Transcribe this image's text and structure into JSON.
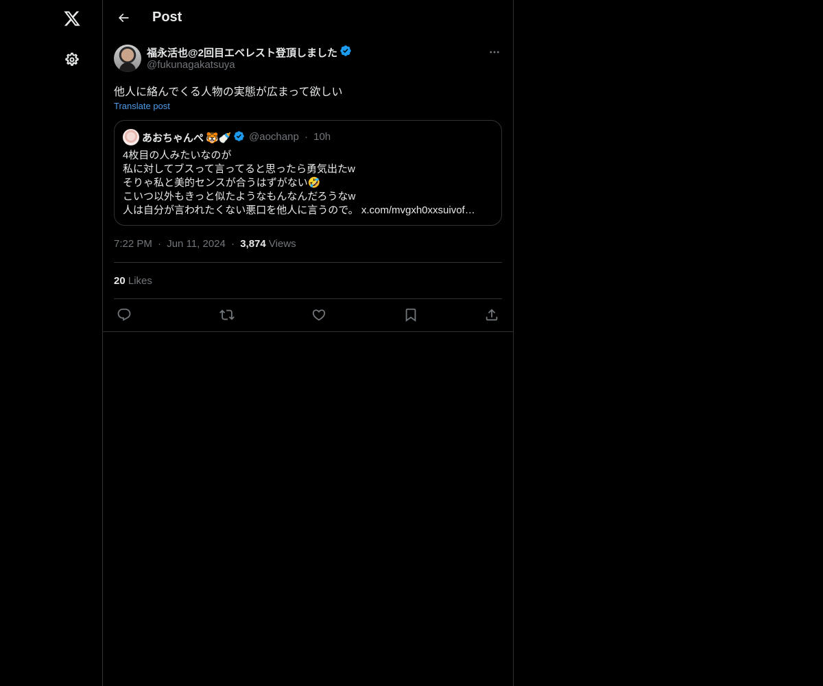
{
  "header": {
    "title": "Post"
  },
  "post": {
    "author_name": "福永活也@2回目エベレスト登頂しました",
    "author_handle": "@fukunagakatsuya",
    "text": "他人に絡んでくる人物の実態が広まって欲しい",
    "translate_label": "Translate post",
    "time": "7:22 PM",
    "date": "Jun 11, 2024",
    "views_count": "3,874",
    "views_label": "Views",
    "likes_count": "20",
    "likes_label": "Likes"
  },
  "quote": {
    "author_name": "あおちゃんぺ",
    "author_emojis": "🐯🍼",
    "author_handle": "@aochanp",
    "separator": "·",
    "age": "10h",
    "lines": [
      "4枚目の人みたいなのが",
      "私に対してブスって言ってると思ったら勇気出たw",
      "そりゃ私と美的センスが合うはずがない🤣",
      "こいつ以外もきっと似たようなもんなんだろうなw",
      "人は自分が言われたくない悪口を他人に言うので。"
    ],
    "link": "x.com/mvgxh0xxsuivof…"
  },
  "icons": {
    "logo": "x-logo-icon",
    "settings": "gear-icon",
    "back": "back-arrow-icon",
    "more": "more-horizontal-icon",
    "verified": "verified-badge-icon",
    "reply": "reply-icon",
    "repost": "repost-icon",
    "like": "heart-icon",
    "bookmark": "bookmark-icon",
    "share": "share-icon"
  },
  "colors": {
    "background": "#000000",
    "text": "#e7e9ea",
    "muted": "#71767b",
    "border": "#2f3336",
    "verified": "#1d9bf0",
    "link": "#4c9be8"
  }
}
